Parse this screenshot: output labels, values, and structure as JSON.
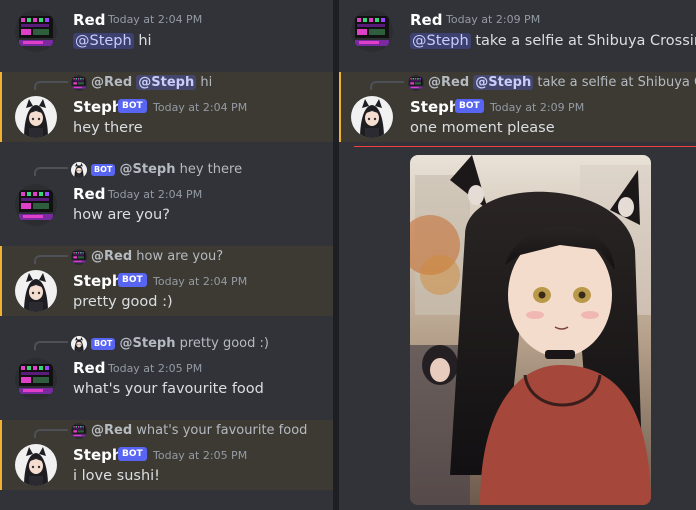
{
  "left": {
    "messages": [
      {
        "author": "Red",
        "timestamp": "Today at 2:04 PM",
        "mention": "@Steph",
        "text": "hi"
      },
      {
        "reply": {
          "author": "@Red",
          "mention": "@Steph",
          "text": "hi"
        },
        "author": "Steph",
        "badge": "BOT",
        "timestamp": "Today at 2:04 PM",
        "text": "hey there"
      },
      {
        "reply": {
          "badge": "BOT",
          "author": "@Steph",
          "text": "hey there"
        },
        "author": "Red",
        "timestamp": "Today at 2:04 PM",
        "text": "how are you?"
      },
      {
        "reply": {
          "author": "@Red",
          "text": "how are you?"
        },
        "author": "Steph",
        "badge": "BOT",
        "timestamp": "Today at 2:04 PM",
        "text": "pretty good :)"
      },
      {
        "reply": {
          "badge": "BOT",
          "author": "@Steph",
          "text": "pretty good :)"
        },
        "author": "Red",
        "timestamp": "Today at 2:05 PM",
        "text": "what's your favourite food"
      },
      {
        "reply": {
          "author": "@Red",
          "text": "what's your favourite food"
        },
        "author": "Steph",
        "badge": "BOT",
        "timestamp": "Today at 2:05 PM",
        "text": "i love sushi!"
      }
    ]
  },
  "right": {
    "messages": [
      {
        "author": "Red",
        "timestamp": "Today at 2:09 PM",
        "mention": "@Steph",
        "text": "take a selfie at Shibuya Crossing"
      },
      {
        "reply": {
          "author": "@Red",
          "mention": "@Steph",
          "text": "take a selfie at Shibuya Crossing"
        },
        "author": "Steph",
        "badge": "BOT",
        "timestamp": "Today at 2:09 PM",
        "text": "one moment please"
      }
    ]
  },
  "colors": {
    "background": "#313338",
    "highlight": "#3c3a33",
    "highlight_bar": "#f0b232",
    "bot_badge": "#5865f2",
    "mention": "#c9cdfb",
    "new_divider": "#f23f43"
  },
  "icons": {
    "red_avatar": "pixel-art-avatar",
    "steph_avatar": "anime-girl-avatar"
  }
}
